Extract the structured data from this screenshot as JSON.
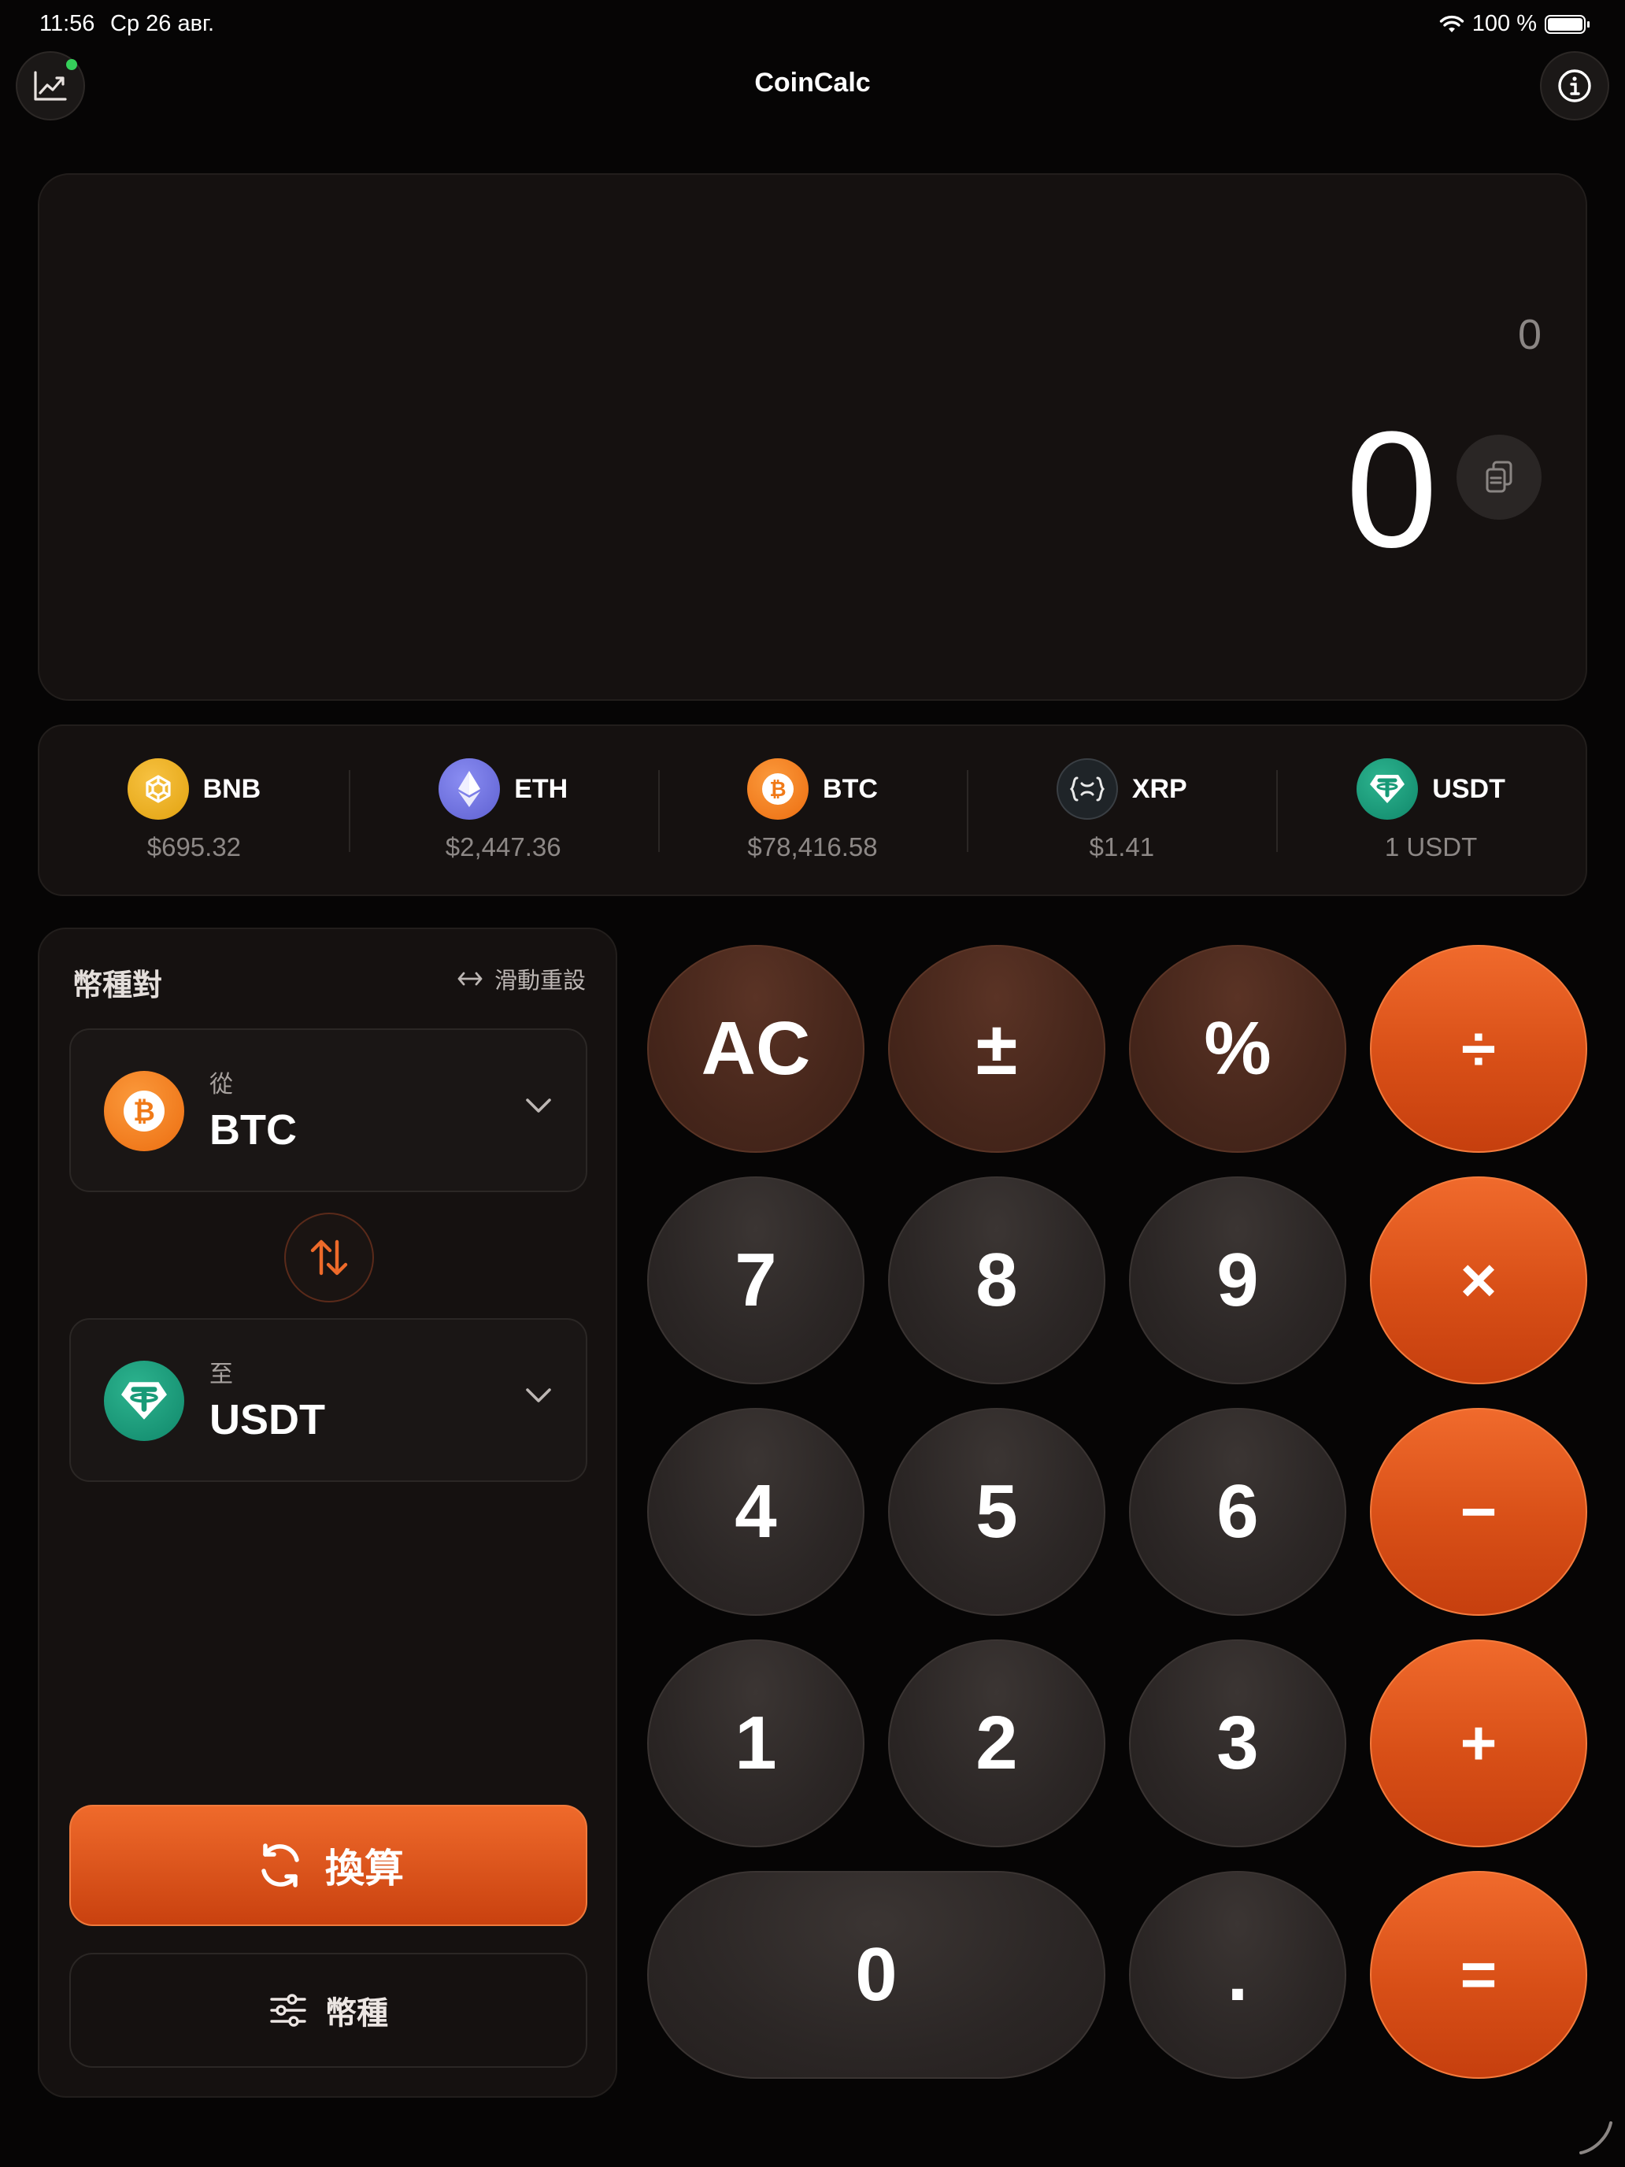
{
  "status": {
    "time": "11:56",
    "date": "Ср 26 авг.",
    "battery": "100 %"
  },
  "header": {
    "title": "CoinCalc",
    "left_icon": "chart-icon",
    "right_icon": "info-icon"
  },
  "display": {
    "expression": "0",
    "result": "0"
  },
  "ticker": [
    {
      "symbol": "BNB",
      "price": "$695.32",
      "color": "#f0b90b"
    },
    {
      "symbol": "ETH",
      "price": "$2,447.36",
      "color": "#627eea"
    },
    {
      "symbol": "BTC",
      "price": "$78,416.58",
      "color": "#f7931a"
    },
    {
      "symbol": "XRP",
      "price": "$1.41",
      "color": "#23292f"
    },
    {
      "symbol": "USDT",
      "price": "1 USDT",
      "color": "#26a17b"
    }
  ],
  "pair": {
    "title": "幣種對",
    "reset_label": "滑動重設",
    "from": {
      "label": "從",
      "code": "BTC"
    },
    "to": {
      "label": "至",
      "code": "USDT"
    },
    "convert_label": "換算",
    "coins_label": "幣種"
  },
  "keypad": {
    "ac": "AC",
    "plusminus": "±",
    "percent": "%",
    "divide": "÷",
    "seven": "7",
    "eight": "8",
    "nine": "9",
    "multiply": "×",
    "four": "4",
    "five": "5",
    "six": "6",
    "minus": "−",
    "one": "1",
    "two": "2",
    "three": "3",
    "plus": "+",
    "zero": "0",
    "dot": ".",
    "equals": "="
  },
  "colors": {
    "accent": "#e85a1e",
    "function_key": "#4a281c",
    "number_key": "#2e2827"
  }
}
